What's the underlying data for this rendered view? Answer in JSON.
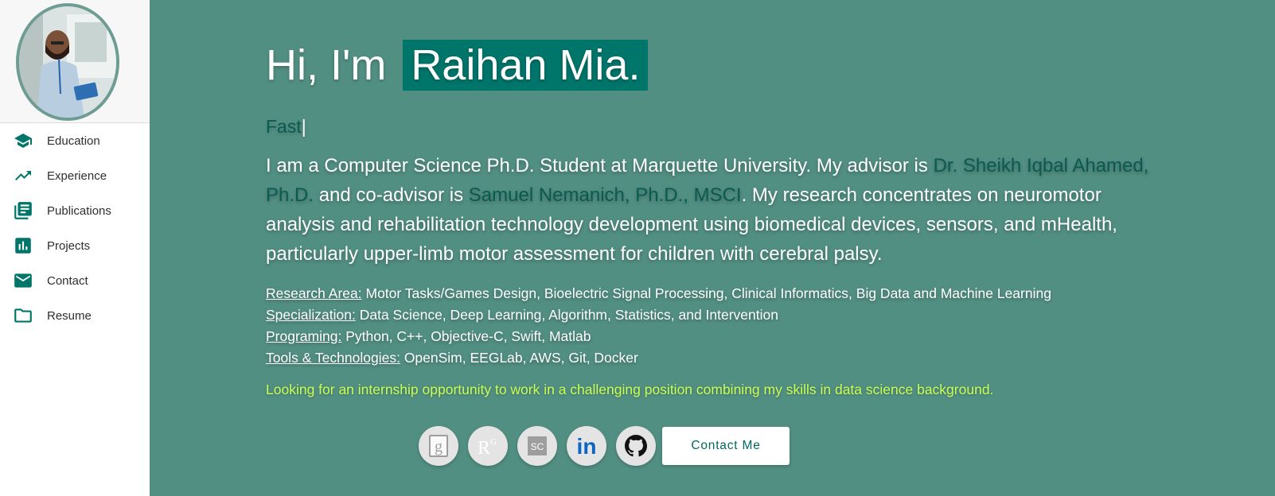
{
  "profile": {
    "greeting": "Hi, I'm ",
    "name": "Raihan Mia.",
    "typed_text": "Fast",
    "cursor": "|"
  },
  "sidebar": {
    "items": [
      {
        "label": "Education",
        "icon": "school-icon"
      },
      {
        "label": "Experience",
        "icon": "trending-up-icon"
      },
      {
        "label": "Publications",
        "icon": "library-books-icon"
      },
      {
        "label": "Projects",
        "icon": "bar-chart-icon"
      },
      {
        "label": "Contact",
        "icon": "mail-icon"
      },
      {
        "label": "Resume",
        "icon": "folder-icon"
      }
    ]
  },
  "bio": {
    "part1": "I am a Computer Science Ph.D. Student at Marquette University. My advisor is ",
    "advisor": "Dr. Sheikh Iqbal Ahamed, Ph.D.",
    "part2": " and co-advisor is ",
    "coadvisor": "Samuel Nemanich, Ph.D., MSCI",
    "part3": ". My research concentrates on neuromotor analysis and rehabilitation technology development using biomedical devices, sensors, and mHealth, particularly upper-limb motor assessment for children with cerebral palsy."
  },
  "skills": [
    {
      "key": "Research Area:",
      "value": " Motor Tasks/Games Design, Bioelectric Signal Processing, Clinical Informatics, Big Data and Machine Learning"
    },
    {
      "key": "Specialization:",
      "value": " Data Science, Deep Learning, Algorithm, Statistics, and Intervention"
    },
    {
      "key": "Programing:",
      "value": " Python, C++, Objective-C, Swift, Matlab"
    },
    {
      "key": "Tools & Technologies:",
      "value": " OpenSim, EEGLab, AWS, Git, Docker"
    }
  ],
  "internship": "Looking for an internship opportunity to work in a challenging position combining my skills in data science background.",
  "social": {
    "google_scholar": {
      "icon": "google-scholar-icon",
      "glyph": "g"
    },
    "researchgate": {
      "icon": "researchgate-icon",
      "glyph": "R",
      "sup": "G"
    },
    "semantic_scholar": {
      "icon": "scholar-sc-icon",
      "glyph": "SC"
    },
    "linkedin": {
      "icon": "linkedin-icon",
      "glyph": "in"
    },
    "github": {
      "icon": "github-icon"
    }
  },
  "contact_button": "Contact Me",
  "colors": {
    "background": "#528f83",
    "accent": "#00756a",
    "link": "#0b5a4f",
    "highlight": "#c9ff52"
  }
}
